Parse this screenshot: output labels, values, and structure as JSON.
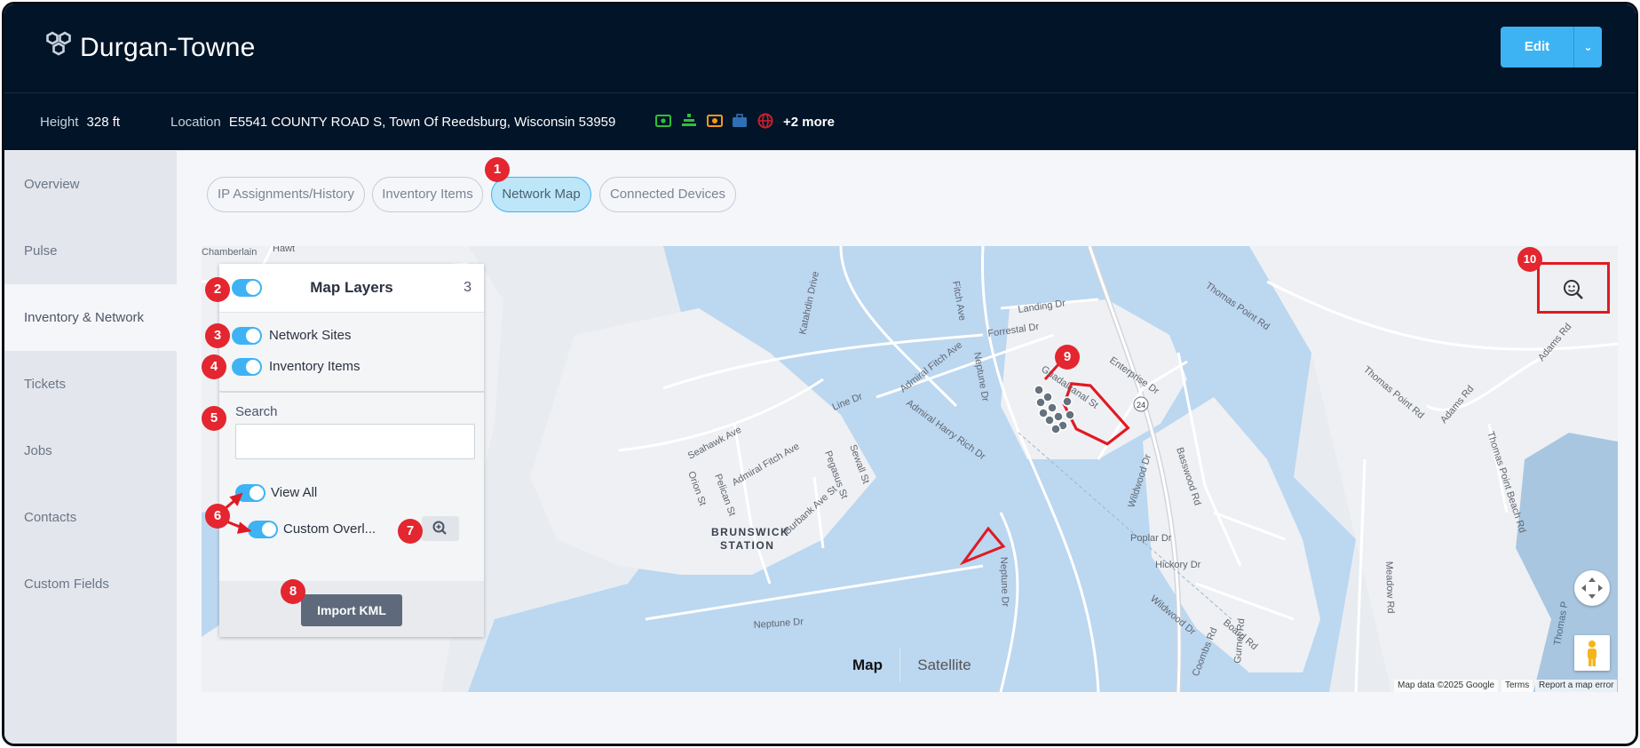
{
  "header": {
    "brand": "Durgan-Towne",
    "edit_label": "Edit",
    "edit_caret": "⌄"
  },
  "info": {
    "height_label": "Height",
    "height_value": "328 ft",
    "location_label": "Location",
    "location_value": "E5541 COUNTY ROAD S, Town Of Reedsburg, Wisconsin 53959",
    "more": "+2 more",
    "badges": [
      {
        "icon": "money-icon",
        "color": "#2fbf3a"
      },
      {
        "icon": "tower-icon",
        "color": "#2fbf3a"
      },
      {
        "icon": "camera-icon",
        "color": "#f2991b"
      },
      {
        "icon": "briefcase-icon",
        "color": "#2f6fb5"
      },
      {
        "icon": "globe-icon",
        "color": "#c8202a"
      }
    ]
  },
  "sidebar": {
    "items": [
      {
        "label": "Overview"
      },
      {
        "label": "Pulse"
      },
      {
        "label": "Inventory & Network",
        "active": true
      },
      {
        "label": "Tickets"
      },
      {
        "label": "Jobs"
      },
      {
        "label": "Contacts"
      },
      {
        "label": "Custom Fields"
      }
    ]
  },
  "tabs": [
    {
      "label": "IP Assignments/History"
    },
    {
      "label": "Inventory Items"
    },
    {
      "label": "Network Map",
      "active": true
    },
    {
      "label": "Connected Devices"
    }
  ],
  "layers": {
    "title": "Map Layers",
    "count": "3",
    "network_sites": "Network Sites",
    "inventory_items": "Inventory Items",
    "search_label": "Search",
    "search_value": "",
    "view_all": "View All",
    "custom_overlay": "Custom Overl...",
    "import_kml": "Import KML"
  },
  "map": {
    "type_map": "Map",
    "type_satellite": "Satellite",
    "attribution": "Map data ©2025 Google",
    "terms": "Terms",
    "report": "Report a map error",
    "labels": {
      "chamberlain": "Chamberlain",
      "hawt": "Hawt",
      "fitch_ave": "Fitch Ave",
      "katahdin": "Katahdin Drive",
      "landing": "Landing Dr",
      "forrestal": "Forrestal Dr",
      "admiral_fitch": "Admiral Fitch Ave",
      "neptune_dr": "Neptune Dr",
      "enterprise": "Enterprise Dr",
      "guadalcanal": "Guadalcanal St",
      "route24": "24",
      "thomas_point_1": "Thomas Point Rd",
      "thomas_point_2": "Thomas Point Rd",
      "thomas_point_beach": "Thomas Point Beach Rd",
      "adams_1": "Adams Rd",
      "adams_2": "Adams Rd",
      "line_dr": "Line Dr",
      "seahawk": "Seahawk Ave",
      "admiral_fitch_2": "Admiral Fitch Ave",
      "admiral_harry": "Admiral Harry Rich Dr",
      "orion": "Orion St",
      "pelican": "Pelican St",
      "sewall": "Sewall St",
      "pegasus": "Pegasus St",
      "burbank": "Burbank Ave St",
      "brunswick_1": "BRUNSWICK",
      "brunswick_2": "STATION",
      "wildwood_1": "Wildwood Dr",
      "basswood": "Basswood Rd",
      "poplar": "Poplar Dr",
      "hickory": "Hickory Dr",
      "wildwood_2": "Wildwood Dr",
      "coombs": "Coombs Rd",
      "board": "Board Rd",
      "gurnet": "Gurnet Rd",
      "meadow": "Meadow Rd",
      "neptune_2": "Neptune Dr",
      "neptune_3": "Neptune Dr",
      "thomas_p": "Thomas P"
    }
  },
  "markers": [
    "1",
    "2",
    "3",
    "4",
    "5",
    "6",
    "7",
    "8",
    "9",
    "10"
  ],
  "colors": {
    "header_bg": "#021428",
    "accent": "#3eb3f4",
    "marker": "#e3262f",
    "import_btn": "#5e6a7b"
  }
}
